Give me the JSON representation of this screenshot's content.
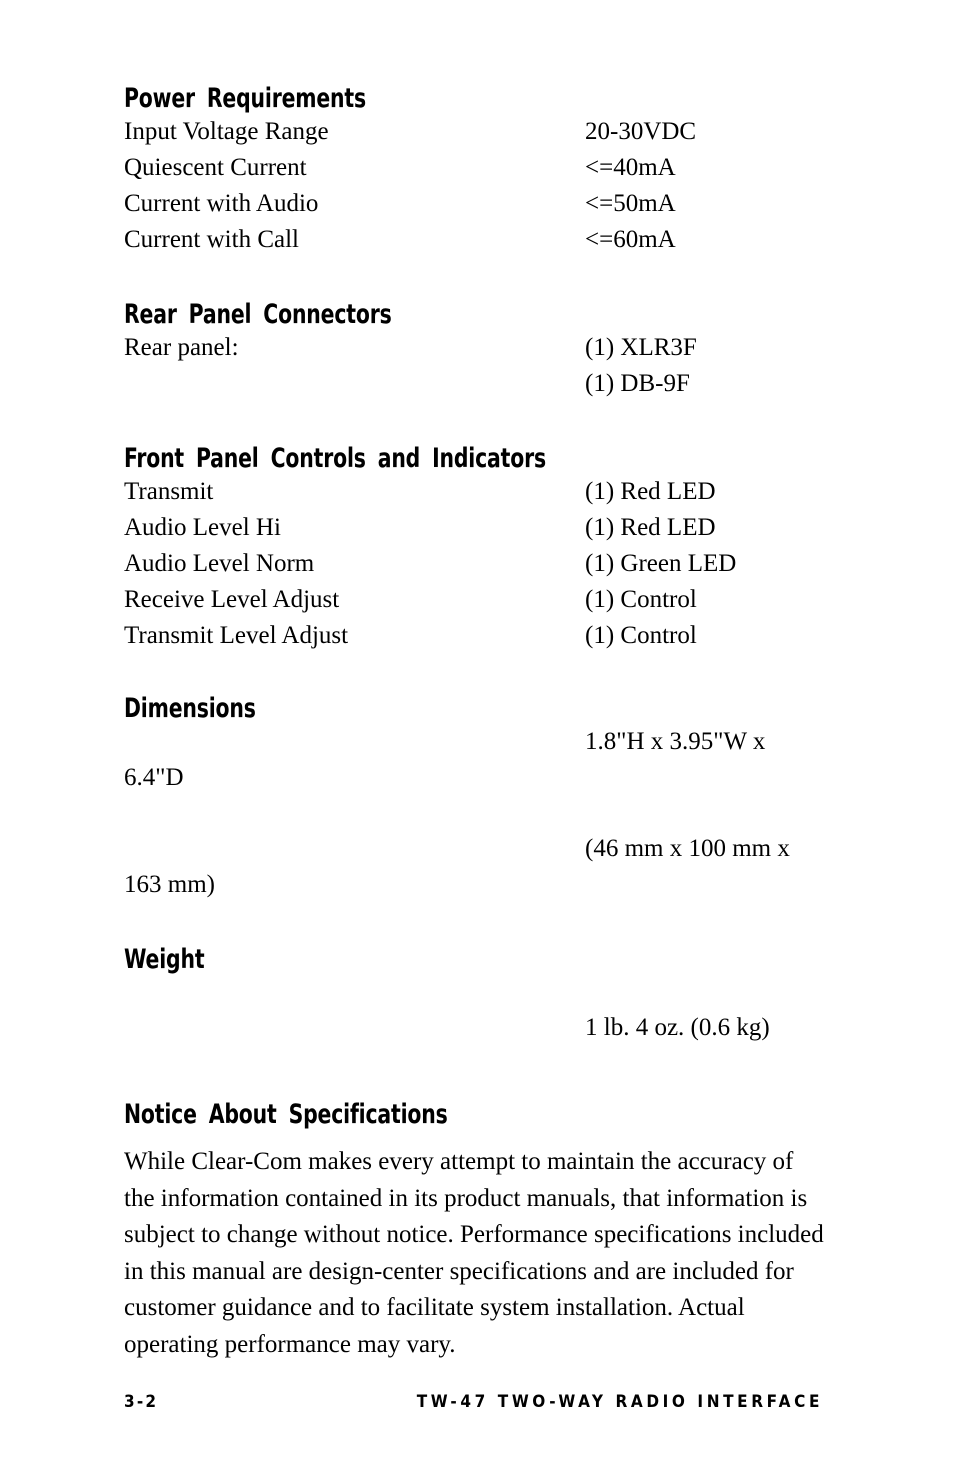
{
  "page": {
    "background_color": "#ffffff",
    "text_color": "#000000"
  },
  "sections": [
    {
      "heading": "Power Requirements",
      "rows": [
        {
          "label": "Input Voltage Range",
          "value": "20-30VDC"
        },
        {
          "label": "Quiescent Current",
          "value": "<=40mA"
        },
        {
          "label": "Current with Audio",
          "value": "<=50mA"
        },
        {
          "label": "Current with Call",
          "value": "<=60mA"
        }
      ]
    },
    {
      "heading": "Rear Panel Connectors",
      "rows": [
        {
          "label": "Rear panel:",
          "value": "(1) XLR3F"
        },
        {
          "label": "",
          "value": "(1) DB-9F"
        }
      ]
    },
    {
      "heading": "Front Panel Controls and Indicators",
      "rows": [
        {
          "label": "Transmit",
          "value": "(1) Red LED"
        },
        {
          "label": "Audio Level Hi",
          "value": "(1) Red LED"
        },
        {
          "label": "Audio Level Norm",
          "value": "(1) Green LED"
        },
        {
          "label": "Receive Level Adjust",
          "value": "(1) Control"
        },
        {
          "label": "Transmit Level Adjust",
          "value": "(1) Control"
        }
      ]
    }
  ],
  "dimensions": {
    "heading": "Dimensions",
    "line_inches_part1": "1.8\"H x 3.95\"W x",
    "line_inches_part2": "6.4\"D",
    "line_mm_part1": "(46 mm x 100 mm x",
    "line_mm_part2": "163 mm)"
  },
  "weight": {
    "heading": "Weight",
    "value": "1 lb. 4 oz. (0.6 kg)"
  },
  "notice": {
    "heading": "Notice About Specifications",
    "body": "While Clear-Com makes every attempt to maintain the accuracy of the information contained in its product manuals, that information is subject to change without notice.  Performance specifications included in this manual are design-center specifications and are included for customer guidance and to facilitate system installation. Actual operating performance may vary."
  },
  "footer": {
    "page_number": "3-2",
    "running_title": "TW-47 TWO-WAY RADIO INTERFACE"
  }
}
